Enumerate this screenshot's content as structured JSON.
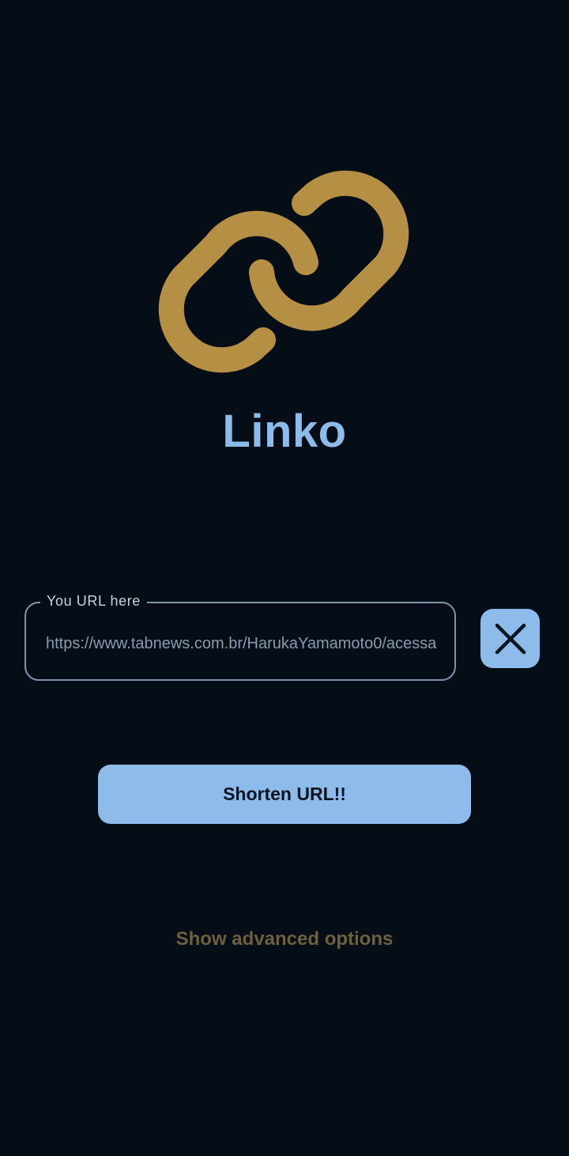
{
  "app": {
    "title": "Linko",
    "logo_icon": "link-icon",
    "accent_color": "#8dbbea",
    "logo_color": "#b58f44",
    "background_color": "#050e17"
  },
  "url_input": {
    "label": "You URL here",
    "value": "https://www.tabnews.com.br/HarukaYamamoto0/acessa"
  },
  "clear_button": {
    "icon": "close-icon"
  },
  "shorten_button": {
    "label": "Shorten URL!!"
  },
  "advanced": {
    "label": "Show advanced options"
  }
}
